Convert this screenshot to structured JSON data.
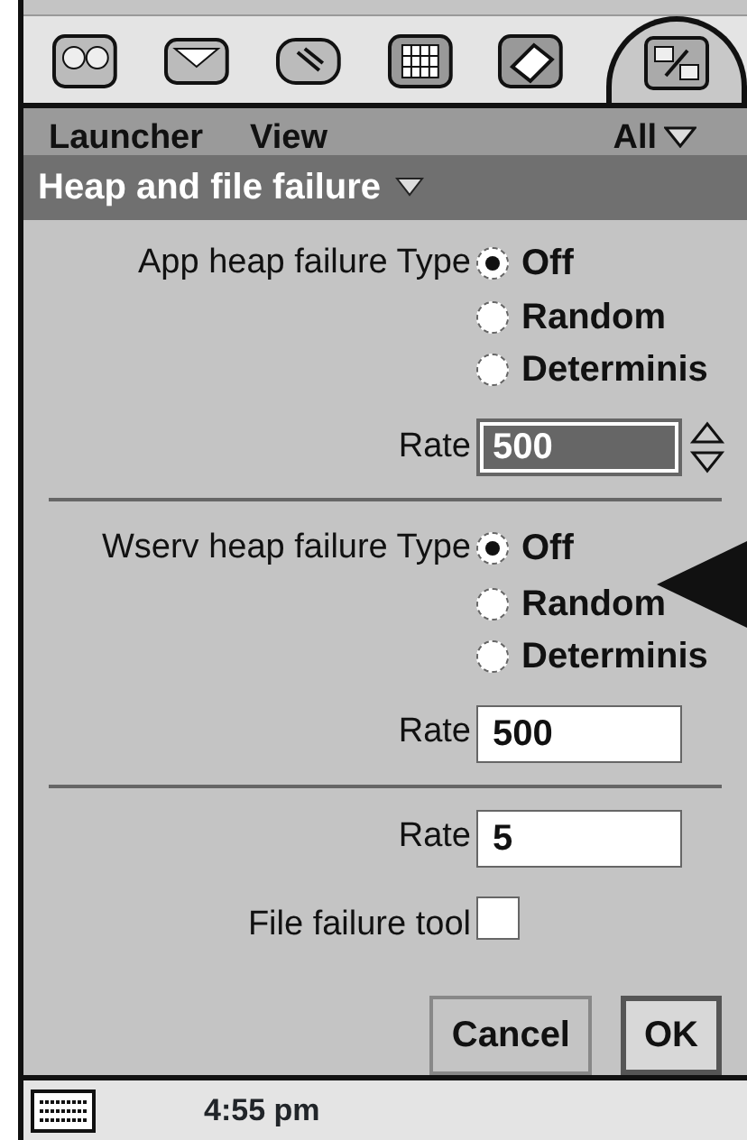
{
  "app_bar": {
    "icons": [
      {
        "selected": false
      },
      {
        "selected": false
      },
      {
        "selected": false
      },
      {
        "selected": false
      },
      {
        "selected": false
      },
      {
        "selected": true
      }
    ]
  },
  "menu_bar": {
    "items": [
      "Launcher",
      "View"
    ],
    "filter": "All"
  },
  "dialog": {
    "title": "Heap and file failure",
    "sections": [
      {
        "label": "App heap failure Type",
        "options": [
          {
            "label": "Off",
            "selected": true
          },
          {
            "label": "Random",
            "selected": false
          },
          {
            "label": "Determinis",
            "selected": false
          }
        ],
        "rate_label": "Rate",
        "rate": "500",
        "focused": true
      },
      {
        "label": "Wserv heap failure Type",
        "options": [
          {
            "label": "Off",
            "selected": true
          },
          {
            "label": "Random",
            "selected": false
          },
          {
            "label": "Determinis",
            "selected": false
          }
        ],
        "rate_label": "Rate",
        "rate": "500",
        "focused": false
      }
    ],
    "file_rate": {
      "label": "Rate",
      "value": "5"
    },
    "file_tool": {
      "label": "File failure tool",
      "checked": false
    },
    "buttons": [
      {
        "label": "Cancel",
        "default": false
      },
      {
        "label": "OK",
        "default": true
      }
    ]
  },
  "status_bar": {
    "time": "4:55 pm"
  }
}
